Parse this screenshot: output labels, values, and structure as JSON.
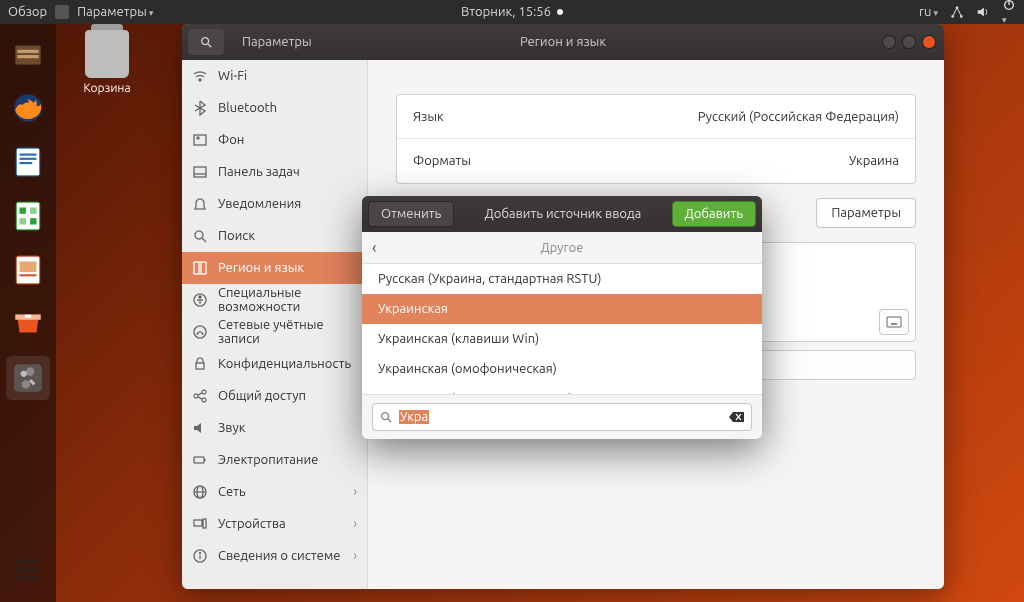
{
  "toppanel": {
    "activities": "Обзор",
    "app_name": "Параметры",
    "clock": "Вторник, 15:56",
    "lang_indicator": "ru"
  },
  "desktop": {
    "trash_label": "Корзина"
  },
  "settings": {
    "title_left": "Параметры",
    "title_center": "Регион и язык",
    "sidebar": [
      {
        "label": "Wi-Fi",
        "icon": "wifi"
      },
      {
        "label": "Bluetooth",
        "icon": "bluetooth"
      },
      {
        "label": "Фон",
        "icon": "background"
      },
      {
        "label": "Панель задач",
        "icon": "dock"
      },
      {
        "label": "Уведомления",
        "icon": "bell"
      },
      {
        "label": "Поиск",
        "icon": "search"
      },
      {
        "label": "Регион и язык",
        "icon": "region",
        "selected": true
      },
      {
        "label": "Специальные возможности",
        "icon": "a11y"
      },
      {
        "label": "Сетевые учётные записи",
        "icon": "accounts"
      },
      {
        "label": "Конфиденциальность",
        "icon": "lock"
      },
      {
        "label": "Общий доступ",
        "icon": "share"
      },
      {
        "label": "Звук",
        "icon": "sound"
      },
      {
        "label": "Электропитание",
        "icon": "power"
      },
      {
        "label": "Сеть",
        "icon": "network",
        "chevron": true
      },
      {
        "label": "Устройства",
        "icon": "devices",
        "chevron": true
      },
      {
        "label": "Сведения о системе",
        "icon": "about",
        "chevron": true
      }
    ],
    "content": {
      "language_label": "Язык",
      "language_value": "Русский (Российская Федерация)",
      "formats_label": "Форматы",
      "formats_value": "Украина",
      "params_button": "Параметры"
    }
  },
  "modal": {
    "cancel": "Отменить",
    "title": "Добавить источник ввода",
    "add": "Добавить",
    "category": "Другое",
    "options": [
      "Русская (Украина, стандартная RSTU)",
      "Украинская",
      "Украинская (клавиши Win)",
      "Украинская (омофоническая)",
      "Украинская (печатная машинка)"
    ],
    "selected_index": 1,
    "search_value": "Укра"
  }
}
